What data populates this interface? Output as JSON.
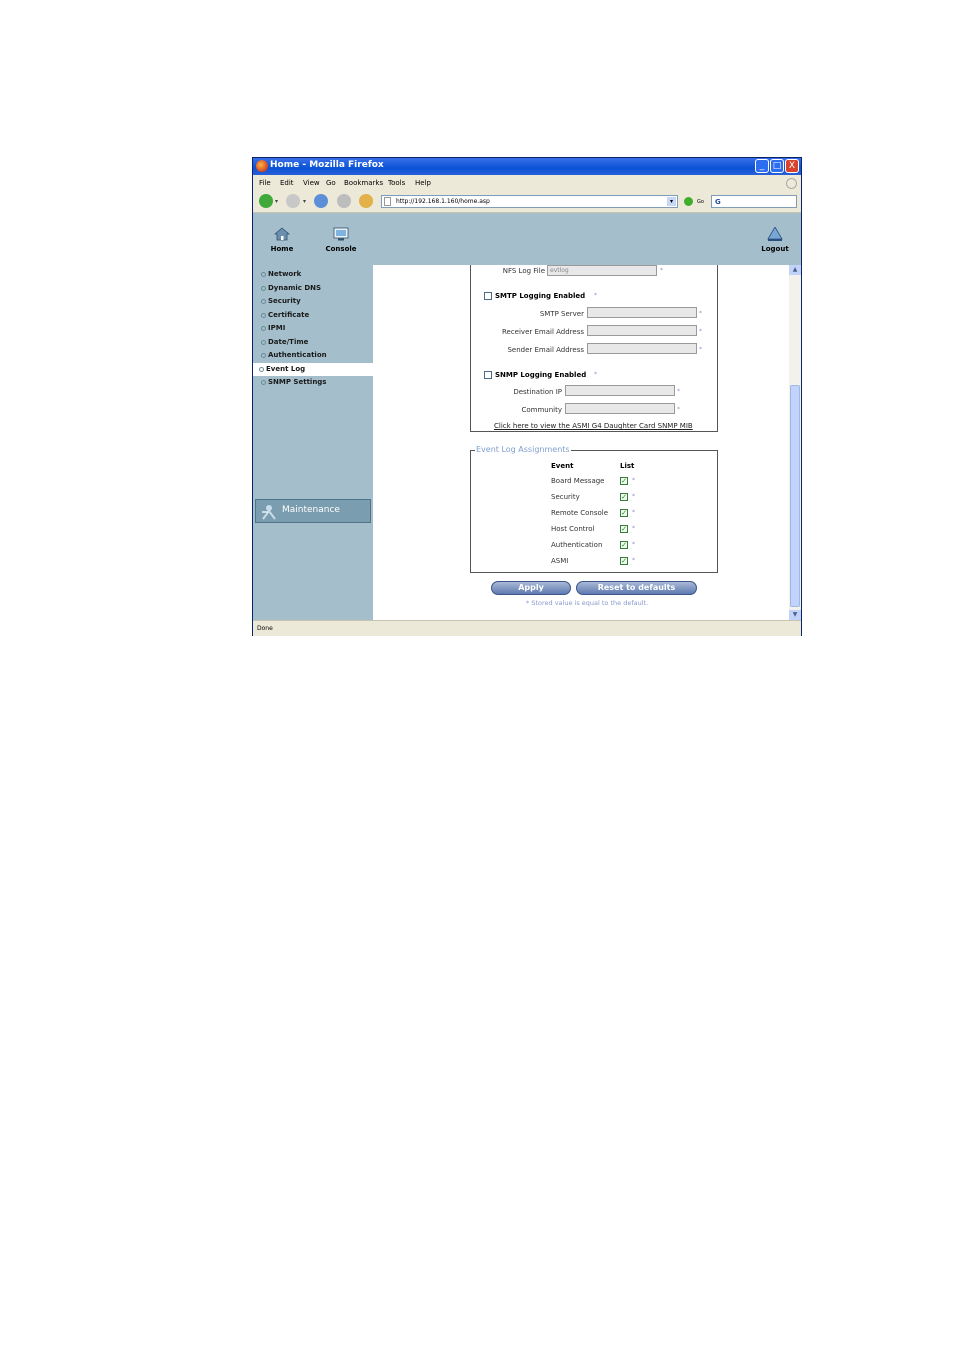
{
  "window": {
    "title": "Home - Mozilla Firefox",
    "controls": [
      "_",
      "□",
      "X"
    ]
  },
  "menu": [
    "File",
    "Edit",
    "View",
    "Go",
    "Bookmarks",
    "Tools",
    "Help"
  ],
  "navbar": {
    "url": "http://192.168.1.160/home.asp",
    "go_label": "Go",
    "search_value": "G"
  },
  "header": {
    "home_label": "Home",
    "console_label": "Console",
    "logout_label": "Logout"
  },
  "sidebar": {
    "items": [
      {
        "label": "Network"
      },
      {
        "label": "Dynamic DNS"
      },
      {
        "label": "Security"
      },
      {
        "label": "Certificate"
      },
      {
        "label": "IPMI"
      },
      {
        "label": "Date/Time"
      },
      {
        "label": "Authentication"
      },
      {
        "label": "Event Log",
        "active": true
      },
      {
        "label": "SNMP Settings"
      }
    ],
    "maintenance_label": "Maintenance"
  },
  "form": {
    "nfs_log_file_label": "NFS Log File",
    "nfs_log_file_value": "evtlog",
    "asterisk": "*",
    "smtp": {
      "enabled_label": "SMTP Logging Enabled",
      "server_label": "SMTP Server",
      "receiver_label": "Receiver Email Address",
      "sender_label": "Sender Email Address"
    },
    "snmp": {
      "enabled_label": "SNMP Logging Enabled",
      "destination_label": "Destination IP",
      "community_label": "Community",
      "mib_link": "Click here to view the ASMI G4 Daughter Card SNMP MIB"
    },
    "assignments": {
      "legend": "Event Log Assignments",
      "col_event": "Event",
      "col_list": "List",
      "rows": [
        {
          "event": "Board Message",
          "checked": true
        },
        {
          "event": "Security",
          "checked": true
        },
        {
          "event": "Remote Console",
          "checked": true
        },
        {
          "event": "Host Control",
          "checked": true
        },
        {
          "event": "Authentication",
          "checked": true
        },
        {
          "event": "ASMI",
          "checked": true
        }
      ]
    },
    "apply_label": "Apply",
    "reset_label": "Reset to defaults",
    "note": "* Stored value is equal to the default."
  },
  "status": {
    "text": "Done"
  }
}
